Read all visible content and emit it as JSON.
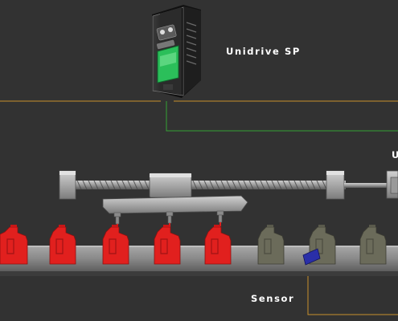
{
  "labels": {
    "drive": "Unidrive SP",
    "sensor": "Sensor",
    "edge_fragment": "U"
  },
  "colors": {
    "background": "#323232",
    "wire_orange": "#c8902c",
    "wire_green": "#34a234",
    "bottle_filled": "#e1201e",
    "bottle_empty": "#6b6b5a",
    "sensor": "#2a2fa8",
    "drive_display": "#2bbf5a"
  },
  "production_line": {
    "filled_bottles": 5,
    "empty_bottles": 3,
    "fill_nozzles": 3
  },
  "icons": [
    "drive-unit-icon",
    "ballscrew-actuator-icon",
    "servo-motor-icon",
    "bottle-icon",
    "sensor-icon"
  ]
}
